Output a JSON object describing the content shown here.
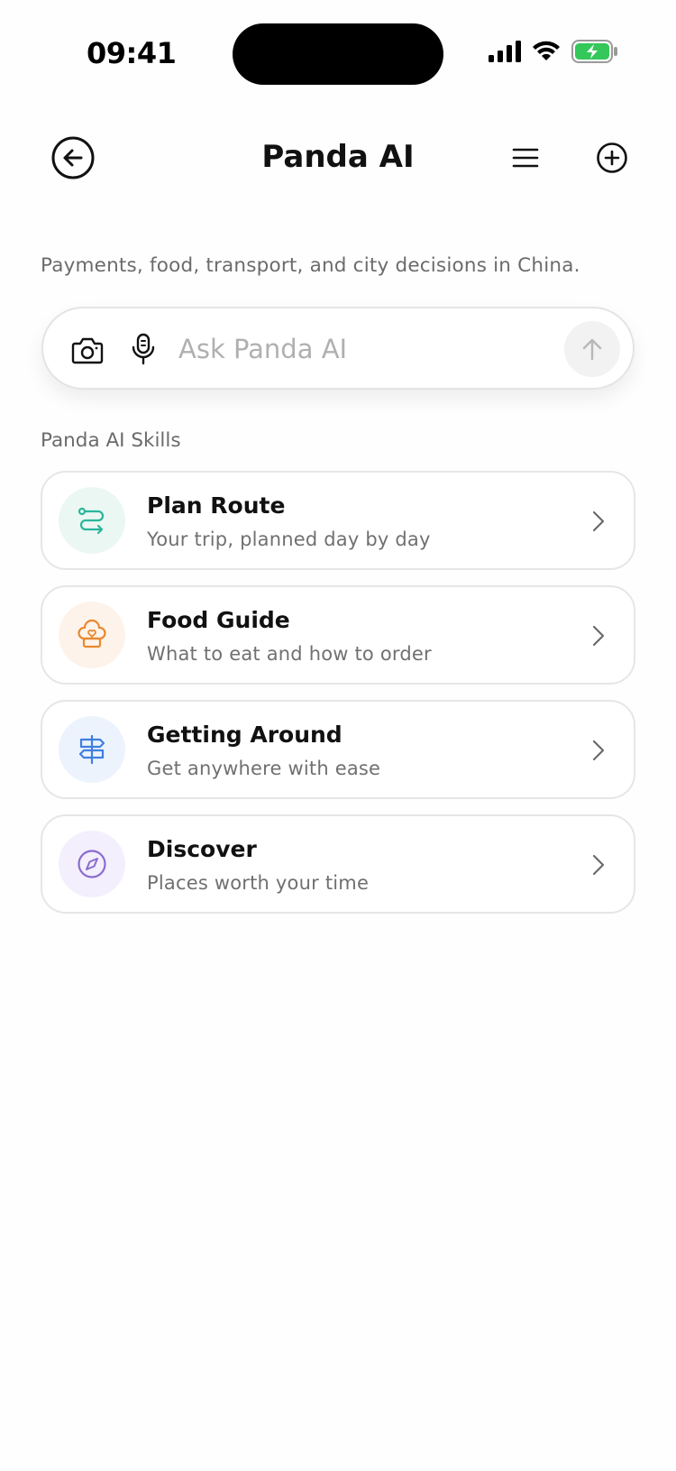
{
  "status": {
    "time": "09:41"
  },
  "header": {
    "title": "Panda AI"
  },
  "subtitle": "Payments, food, transport, and city decisions in China.",
  "ask": {
    "placeholder": "Ask Panda AI"
  },
  "skills": {
    "section_label": "Panda AI Skills",
    "items": [
      {
        "title": "Plan Route",
        "description": "Your trip, planned day by day",
        "icon": "route-icon",
        "color": "#2bb59a",
        "bg": "#eaf7f3"
      },
      {
        "title": "Food Guide",
        "description": "What to eat and how to order",
        "icon": "chef-hat-icon",
        "color": "#e8892e",
        "bg": "#fdf3ea"
      },
      {
        "title": "Getting Around",
        "description": "Get anywhere with ease",
        "icon": "signpost-icon",
        "color": "#3f7fe0",
        "bg": "#edf3fd"
      },
      {
        "title": "Discover",
        "description": "Places worth your time",
        "icon": "compass-icon",
        "color": "#8a6bd1",
        "bg": "#f3effc"
      }
    ]
  },
  "colors": {
    "battery": "#34c759",
    "placeholder": "#b0b0b0"
  }
}
